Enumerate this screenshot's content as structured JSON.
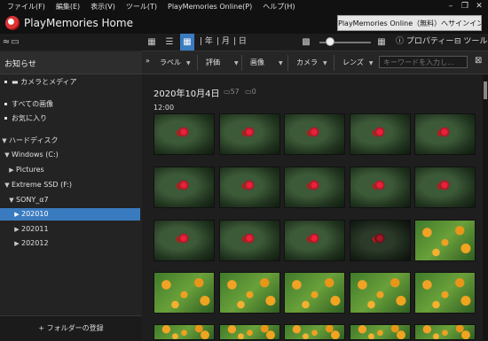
{
  "menubar": {
    "items": [
      "ファイル(F)",
      "編集(E)",
      "表示(V)",
      "ツール(T)",
      "PlayMemories Online(P)",
      "ヘルプ(H)"
    ]
  },
  "window": {
    "title": "PlayMemories Home",
    "minimize": "–",
    "restore": "❐",
    "close": "✕"
  },
  "header": {
    "online_link": "PlayMemories Online（無料）へサインイン"
  },
  "toolbar": {
    "view_year": "年",
    "view_month": "月",
    "view_day": "日",
    "properties_label": "プロパティー",
    "tools_label": "ツール",
    "zoom_level": 0.2
  },
  "sidebar": {
    "notice": "お知らせ",
    "items": [
      {
        "label": "カメラとメディア"
      },
      {
        "label": "すべての画像"
      },
      {
        "label": "お気に入り"
      },
      {
        "label": "ハードディスク"
      },
      {
        "label": "Windows (C:)"
      },
      {
        "label": "Pictures"
      },
      {
        "label": "Extreme SSD (F:)"
      },
      {
        "label": "SONY_α7"
      },
      {
        "label": "202010",
        "selected": true
      },
      {
        "label": "202011"
      },
      {
        "label": "202012"
      }
    ],
    "register_folder": "+ フォルダーの登録"
  },
  "filters": {
    "label": "ラベル",
    "rating": "評価",
    "image": "画像",
    "camera": "カメラ",
    "lens": "レンズ",
    "search_placeholder": "キーワードを入力し…"
  },
  "content": {
    "date": "2020年10月4日",
    "photo_count": "57",
    "video_count": "0",
    "time": "12:00"
  },
  "icons": {
    "sidebar_toggle": "collapse-icon",
    "monitor": "monitor-icon",
    "grid_large": "grid-large-icon",
    "list": "list-icon",
    "check": "check-icon",
    "calendar": "calendar-icon",
    "thumb_small": "grid-small-icon",
    "thumb_large": "grid-large-icon",
    "info": "info-icon",
    "toolbox": "toolbox-icon",
    "filter_collapse": "double-chevron-icon",
    "close": "close-icon"
  },
  "colors": {
    "accent": "#3a7bbf",
    "background": "#1a1a1a"
  },
  "thumbnail_rows": [
    [
      "red",
      "red",
      "red",
      "red",
      "red"
    ],
    [
      "red",
      "red",
      "red",
      "red",
      "red"
    ],
    [
      "red",
      "red",
      "red",
      "dark",
      "orange"
    ],
    [
      "orange",
      "orange",
      "orange",
      "orange",
      "orange"
    ],
    [
      "orange",
      "orange",
      "orange",
      "orange",
      "orange"
    ]
  ]
}
